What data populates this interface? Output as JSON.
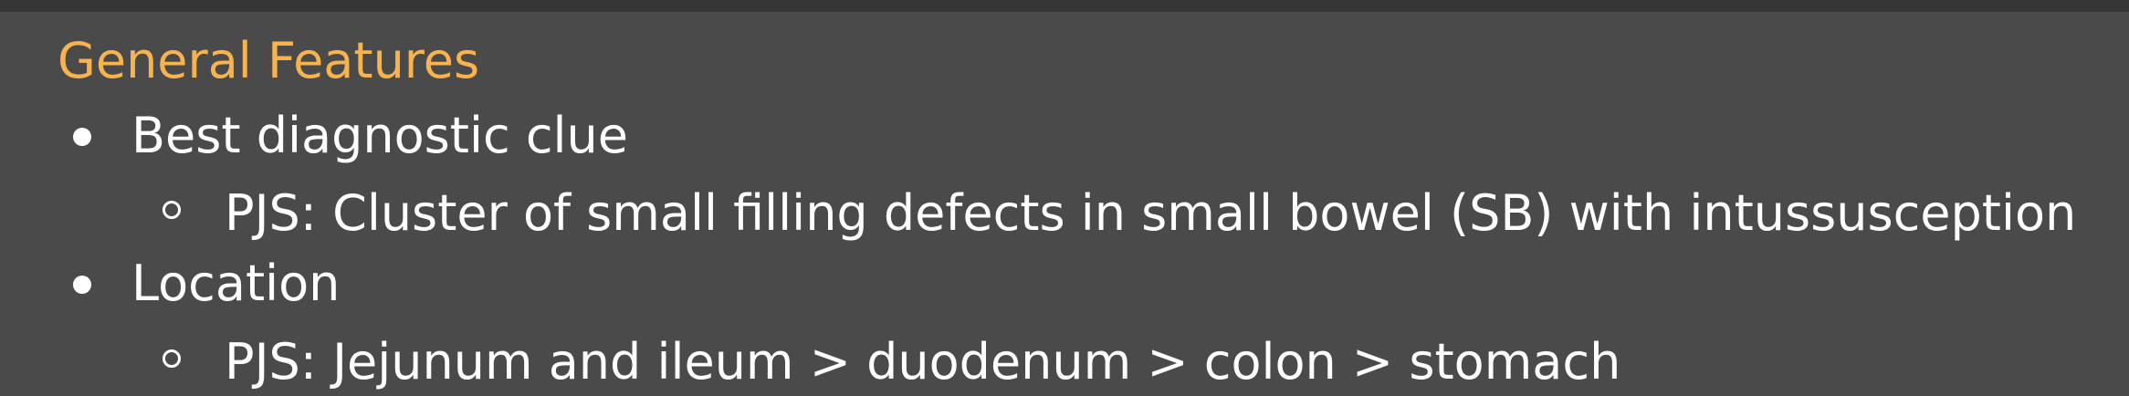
{
  "section": {
    "title": "General Features"
  },
  "items": [
    {
      "label": "Best diagnostic clue",
      "sub": [
        "PJS: Cluster of small filling defects in small bowel (SB) with intussusception"
      ]
    },
    {
      "label": "Location",
      "sub": [
        "PJS: Jejunum and ileum > duodenum > colon > stomach"
      ]
    }
  ],
  "colors": {
    "background": "#4a4a4a",
    "top_bar": "#363636",
    "heading": "#f8b24e",
    "text": "#ffffff"
  }
}
